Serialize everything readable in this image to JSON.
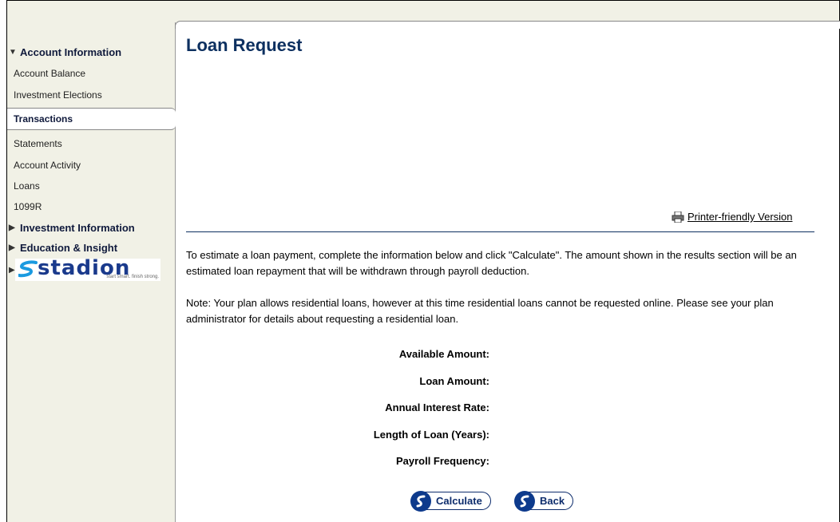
{
  "sidebar": {
    "sections": [
      {
        "label": "Account Information",
        "expanded": true
      },
      {
        "label": "Investment Information",
        "expanded": false
      },
      {
        "label": "Education & Insight",
        "expanded": false
      }
    ],
    "items": [
      {
        "label": "Account Balance"
      },
      {
        "label": "Investment Elections"
      },
      {
        "label": "Transactions",
        "active": true
      },
      {
        "label": "Statements"
      },
      {
        "label": "Account Activity"
      },
      {
        "label": "Loans"
      },
      {
        "label": "1099R"
      }
    ],
    "logo": {
      "text": "stadion",
      "tagline": "start smart. finish strong."
    }
  },
  "main": {
    "title": "Loan Request",
    "printer_link": "Printer-friendly Version",
    "intro": "To estimate a loan payment, complete the information below and click \"Calculate\". The amount shown in the results section will be an estimated loan repayment that will be withdrawn through payroll deduction.",
    "note": "Note: Your plan allows residential loans, however at this time residential loans cannot be requested online. Please see your plan administrator for details about requesting a residential loan.",
    "fields": [
      {
        "label": "Available Amount:"
      },
      {
        "label": "Loan Amount:"
      },
      {
        "label": "Annual Interest Rate:"
      },
      {
        "label": "Length of Loan (Years):"
      },
      {
        "label": "Payroll Frequency:"
      }
    ],
    "buttons": {
      "calculate": "Calculate",
      "back": "Back"
    }
  },
  "colors": {
    "sidebar_bg": "#f1f1e6",
    "title": "#0d3060",
    "button": "#0d3a8c"
  }
}
